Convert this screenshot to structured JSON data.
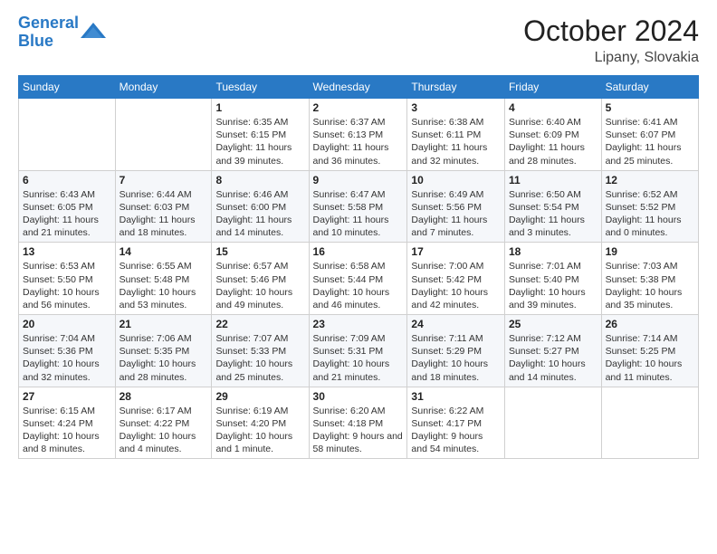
{
  "header": {
    "logo_line1": "General",
    "logo_line2": "Blue",
    "month": "October 2024",
    "location": "Lipany, Slovakia"
  },
  "weekdays": [
    "Sunday",
    "Monday",
    "Tuesday",
    "Wednesday",
    "Thursday",
    "Friday",
    "Saturday"
  ],
  "weeks": [
    [
      {
        "day": "",
        "info": ""
      },
      {
        "day": "",
        "info": ""
      },
      {
        "day": "1",
        "info": "Sunrise: 6:35 AM\nSunset: 6:15 PM\nDaylight: 11 hours and 39 minutes."
      },
      {
        "day": "2",
        "info": "Sunrise: 6:37 AM\nSunset: 6:13 PM\nDaylight: 11 hours and 36 minutes."
      },
      {
        "day": "3",
        "info": "Sunrise: 6:38 AM\nSunset: 6:11 PM\nDaylight: 11 hours and 32 minutes."
      },
      {
        "day": "4",
        "info": "Sunrise: 6:40 AM\nSunset: 6:09 PM\nDaylight: 11 hours and 28 minutes."
      },
      {
        "day": "5",
        "info": "Sunrise: 6:41 AM\nSunset: 6:07 PM\nDaylight: 11 hours and 25 minutes."
      }
    ],
    [
      {
        "day": "6",
        "info": "Sunrise: 6:43 AM\nSunset: 6:05 PM\nDaylight: 11 hours and 21 minutes."
      },
      {
        "day": "7",
        "info": "Sunrise: 6:44 AM\nSunset: 6:03 PM\nDaylight: 11 hours and 18 minutes."
      },
      {
        "day": "8",
        "info": "Sunrise: 6:46 AM\nSunset: 6:00 PM\nDaylight: 11 hours and 14 minutes."
      },
      {
        "day": "9",
        "info": "Sunrise: 6:47 AM\nSunset: 5:58 PM\nDaylight: 11 hours and 10 minutes."
      },
      {
        "day": "10",
        "info": "Sunrise: 6:49 AM\nSunset: 5:56 PM\nDaylight: 11 hours and 7 minutes."
      },
      {
        "day": "11",
        "info": "Sunrise: 6:50 AM\nSunset: 5:54 PM\nDaylight: 11 hours and 3 minutes."
      },
      {
        "day": "12",
        "info": "Sunrise: 6:52 AM\nSunset: 5:52 PM\nDaylight: 11 hours and 0 minutes."
      }
    ],
    [
      {
        "day": "13",
        "info": "Sunrise: 6:53 AM\nSunset: 5:50 PM\nDaylight: 10 hours and 56 minutes."
      },
      {
        "day": "14",
        "info": "Sunrise: 6:55 AM\nSunset: 5:48 PM\nDaylight: 10 hours and 53 minutes."
      },
      {
        "day": "15",
        "info": "Sunrise: 6:57 AM\nSunset: 5:46 PM\nDaylight: 10 hours and 49 minutes."
      },
      {
        "day": "16",
        "info": "Sunrise: 6:58 AM\nSunset: 5:44 PM\nDaylight: 10 hours and 46 minutes."
      },
      {
        "day": "17",
        "info": "Sunrise: 7:00 AM\nSunset: 5:42 PM\nDaylight: 10 hours and 42 minutes."
      },
      {
        "day": "18",
        "info": "Sunrise: 7:01 AM\nSunset: 5:40 PM\nDaylight: 10 hours and 39 minutes."
      },
      {
        "day": "19",
        "info": "Sunrise: 7:03 AM\nSunset: 5:38 PM\nDaylight: 10 hours and 35 minutes."
      }
    ],
    [
      {
        "day": "20",
        "info": "Sunrise: 7:04 AM\nSunset: 5:36 PM\nDaylight: 10 hours and 32 minutes."
      },
      {
        "day": "21",
        "info": "Sunrise: 7:06 AM\nSunset: 5:35 PM\nDaylight: 10 hours and 28 minutes."
      },
      {
        "day": "22",
        "info": "Sunrise: 7:07 AM\nSunset: 5:33 PM\nDaylight: 10 hours and 25 minutes."
      },
      {
        "day": "23",
        "info": "Sunrise: 7:09 AM\nSunset: 5:31 PM\nDaylight: 10 hours and 21 minutes."
      },
      {
        "day": "24",
        "info": "Sunrise: 7:11 AM\nSunset: 5:29 PM\nDaylight: 10 hours and 18 minutes."
      },
      {
        "day": "25",
        "info": "Sunrise: 7:12 AM\nSunset: 5:27 PM\nDaylight: 10 hours and 14 minutes."
      },
      {
        "day": "26",
        "info": "Sunrise: 7:14 AM\nSunset: 5:25 PM\nDaylight: 10 hours and 11 minutes."
      }
    ],
    [
      {
        "day": "27",
        "info": "Sunrise: 6:15 AM\nSunset: 4:24 PM\nDaylight: 10 hours and 8 minutes."
      },
      {
        "day": "28",
        "info": "Sunrise: 6:17 AM\nSunset: 4:22 PM\nDaylight: 10 hours and 4 minutes."
      },
      {
        "day": "29",
        "info": "Sunrise: 6:19 AM\nSunset: 4:20 PM\nDaylight: 10 hours and 1 minute."
      },
      {
        "day": "30",
        "info": "Sunrise: 6:20 AM\nSunset: 4:18 PM\nDaylight: 9 hours and 58 minutes."
      },
      {
        "day": "31",
        "info": "Sunrise: 6:22 AM\nSunset: 4:17 PM\nDaylight: 9 hours and 54 minutes."
      },
      {
        "day": "",
        "info": ""
      },
      {
        "day": "",
        "info": ""
      }
    ]
  ]
}
